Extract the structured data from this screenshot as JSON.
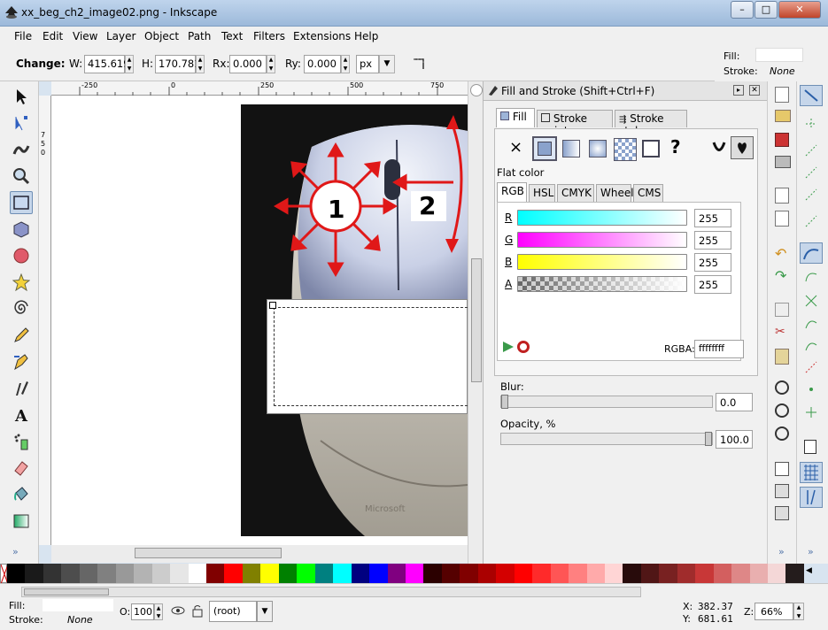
{
  "window": {
    "title": "xx_beg_ch2_image02.png - Inkscape",
    "min": "–",
    "max": "□",
    "close": "✕"
  },
  "menu": [
    "File",
    "Edit",
    "View",
    "Layer",
    "Object",
    "Path",
    "Text",
    "Filters",
    "Extensions",
    "Help"
  ],
  "controls": {
    "change_label": "Change:",
    "w_label": "W:",
    "w_value": "415.619",
    "h_label": "H:",
    "h_value": "170.781",
    "rx_label": "Rx:",
    "rx_value": "0.000",
    "ry_label": "Ry:",
    "ry_value": "0.000",
    "unit": "px"
  },
  "style_indicator": {
    "fill_label": "Fill:",
    "stroke_label": "Stroke:",
    "stroke_value": "None"
  },
  "ruler_top": [
    "-250",
    "0",
    "250",
    "500",
    "750"
  ],
  "ruler_left": [
    "7",
    "5",
    "0"
  ],
  "canvas": {
    "label1": "1",
    "label2": "2"
  },
  "dialog": {
    "title": "Fill and Stroke (Shift+Ctrl+F)",
    "tabs": [
      "Fill",
      "Stroke paint",
      "Stroke style"
    ],
    "paint_none": "×",
    "paint_unknown": "?",
    "flat_color_label": "Flat color",
    "mode_tabs": [
      "RGB",
      "HSL",
      "CMYK",
      "Wheel",
      "CMS"
    ],
    "channels": [
      {
        "label": "R",
        "value": "255"
      },
      {
        "label": "G",
        "value": "255"
      },
      {
        "label": "B",
        "value": "255"
      },
      {
        "label": "A",
        "value": "255"
      }
    ],
    "rgba_label": "RGBA:",
    "rgba_value": "ffffffff",
    "blur_label": "Blur:",
    "blur_value": "0.0",
    "opacity_label": "Opacity, %",
    "opacity_value": "100.0",
    "blur_level": 0.0,
    "opacity_level": 1.0
  },
  "palette_colors": [
    "#000000",
    "#1a1a1a",
    "#333333",
    "#4d4d4d",
    "#666666",
    "#808080",
    "#999999",
    "#b3b3b3",
    "#cccccc",
    "#e6e6e6",
    "#ffffff",
    "#800000",
    "#ff0000",
    "#808000",
    "#ffff00",
    "#008000",
    "#00ff00",
    "#008080",
    "#00ffff",
    "#000080",
    "#0000ff",
    "#800080",
    "#ff00ff",
    "#2b0000",
    "#550000",
    "#800000",
    "#aa0000",
    "#d40000",
    "#ff0000",
    "#ff2a2a",
    "#ff5555",
    "#ff8080",
    "#ffaaaa",
    "#ffd5d5",
    "#280b0b",
    "#501616",
    "#782121",
    "#a02c2c",
    "#c83737",
    "#d35f5f",
    "#de8787",
    "#e9afaf",
    "#f4d7d7",
    "#241c1c"
  ],
  "status": {
    "fill_label": "Fill:",
    "stroke_label": "Stroke:",
    "stroke_value": "None",
    "o_label": "O:",
    "o_value": "100",
    "layer": "(root)",
    "x_label": "X:",
    "x_value": "382.37",
    "y_label": "Y:",
    "y_value": "681.61",
    "z_label": "Z:",
    "zoom": "66%"
  }
}
